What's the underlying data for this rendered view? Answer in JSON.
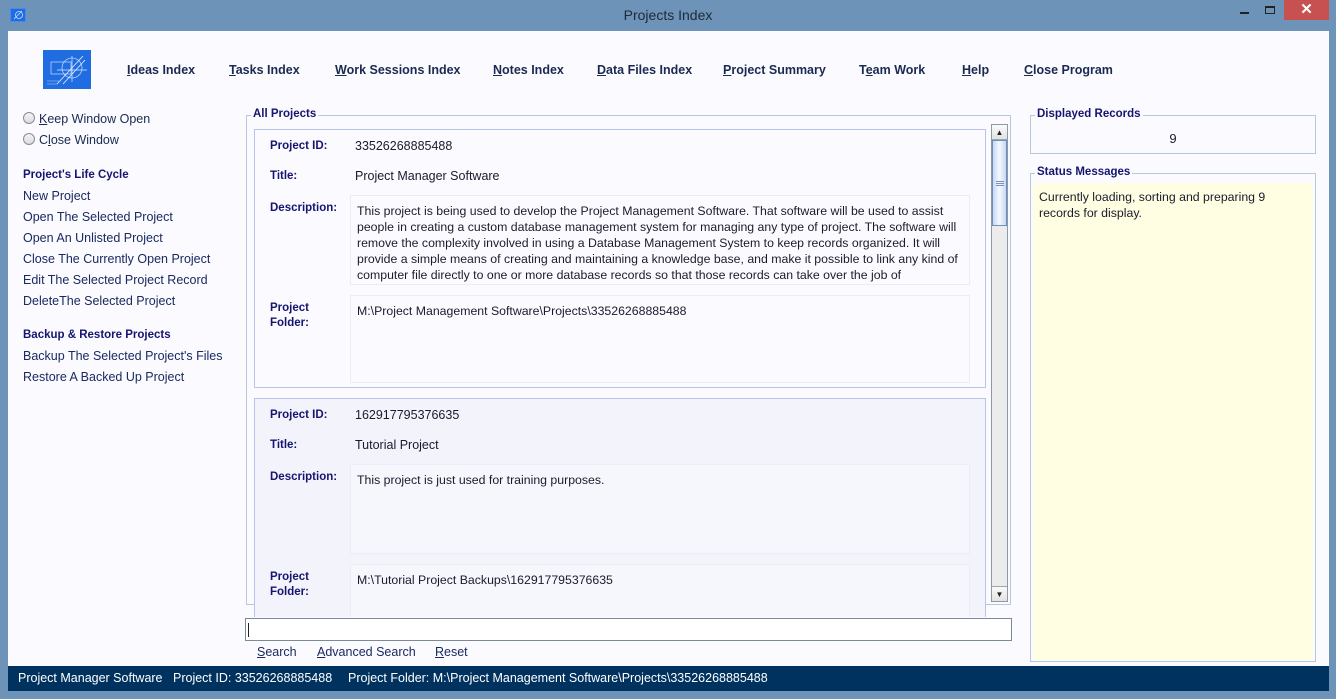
{
  "window": {
    "title": "Projects Index",
    "close_glyph": "✕"
  },
  "menu": [
    {
      "accel": "I",
      "rest": "deas Index"
    },
    {
      "accel": "T",
      "rest": "asks Index"
    },
    {
      "accel": "W",
      "rest": "ork Sessions Index"
    },
    {
      "accel": "N",
      "rest": "otes Index"
    },
    {
      "accel": "D",
      "rest": "ata Files Index"
    },
    {
      "accel": "P",
      "rest": "roject Summary"
    },
    {
      "pre": "T",
      "accel": "e",
      "rest": "am Work"
    },
    {
      "accel": "H",
      "rest": "elp"
    },
    {
      "accel": "C",
      "rest": "lose Program"
    }
  ],
  "sidebar": {
    "radios": [
      {
        "accel": "K",
        "rest": "eep Window Open",
        "selected": false
      },
      {
        "pre": "C",
        "accel": "l",
        "rest": "ose Window",
        "selected": false
      }
    ],
    "lifecycle_heading": "Project's Life Cycle",
    "lifecycle_items": [
      "New Project",
      "Open The Selected Project",
      "Open An Unlisted Project",
      "Close The Currently Open Project",
      "Edit The Selected Project Record",
      "DeleteThe Selected Project"
    ],
    "backup_heading": "Backup & Restore Projects",
    "backup_items": [
      "Backup The Selected Project's Files",
      "Restore A Backed Up Project"
    ]
  },
  "projects": {
    "legend": "All Projects",
    "labels": {
      "id": "Project ID:",
      "title": "Title:",
      "description": "Description:",
      "folder_line1": "Project",
      "folder_line2": "Folder:"
    },
    "records": [
      {
        "id": "33526268885488",
        "title": "Project Manager Software",
        "description": "This project is being used to develop the Project Management Software. That software will be used to assist people in creating a custom database management system for managing any type of project. The software will remove the complexity involved in using a Database Management System to keep records organized. It will provide a simple means of creating and maintaining a knowledge base, and make it possible to link any kind of computer file directly to one or more database records so that those records can take over the job of",
        "folder": "M:\\Project Management Software\\Projects\\33526268885488"
      },
      {
        "id": "162917795376635",
        "title": "Tutorial Project",
        "description": "This project is just used for training purposes.",
        "folder": "M:\\Tutorial Project Backups\\162917795376635"
      }
    ]
  },
  "search": {
    "value": "",
    "links": [
      {
        "accel": "S",
        "rest": "earch"
      },
      {
        "accel": "A",
        "rest": "dvanced Search"
      },
      {
        "accel": "R",
        "rest": "eset"
      }
    ]
  },
  "right_panel": {
    "records_legend": "Displayed Records",
    "records_count": "9",
    "status_legend": "Status Messages",
    "status_message": "Currently loading, sorting and preparing 9 records for display."
  },
  "status_bar": {
    "project_title": "Project Manager Software",
    "project_id": "Project ID:  33526268885488",
    "project_folder": "Project Folder: M:\\Project Management Software\\Projects\\33526268885488"
  }
}
